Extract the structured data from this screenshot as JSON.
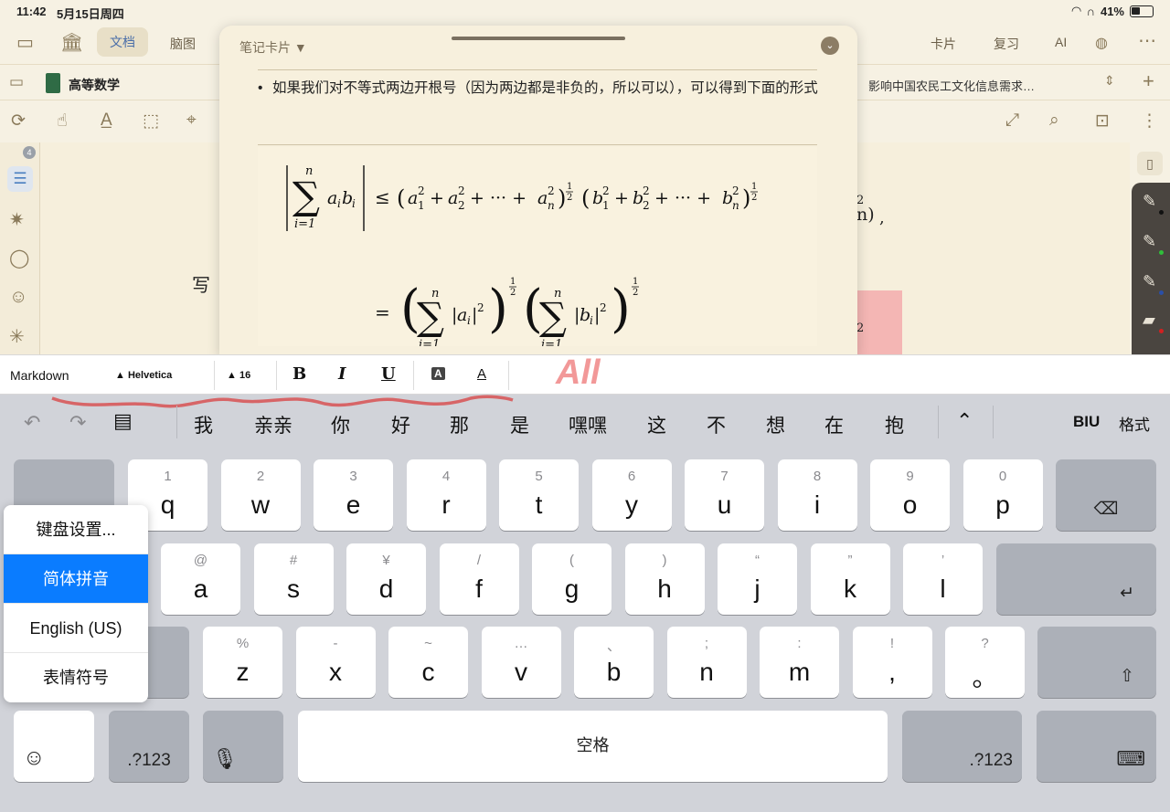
{
  "status": {
    "time": "11:42",
    "date": "5月15日周四",
    "battery": "41%"
  },
  "topbar": {
    "tab_doc": "文档",
    "tab_map": "脑图",
    "right_items": [
      "卡片",
      "复习",
      "AI"
    ]
  },
  "tabs": {
    "current_doc": "高等数学",
    "other_doc": "影响中国农民工文化信息需求…"
  },
  "left_badge": "4",
  "background": {
    "left_text": "写",
    "right_frag": "2",
    "right_frag2": "n)",
    "right_comma": ","
  },
  "card": {
    "header": "笔记卡片 ▼",
    "bullet": "如果我们对不等式两边开根号（因为两边都是非负的，所以可以），可以得到下面的形式"
  },
  "format_bar": {
    "mode": "Markdown",
    "font": "Helvetica",
    "size": "16",
    "bold": "B",
    "italic": "I",
    "underline": "U",
    "bg_a": "A",
    "fg_a": "A",
    "ink_mark": "All"
  },
  "keyboard": {
    "candidates": [
      "我",
      "亲亲",
      "你",
      "好",
      "那",
      "是",
      "嘿嘿",
      "这",
      "不",
      "想",
      "在",
      "抱"
    ],
    "right_biu": "BIU",
    "right_format": "格式",
    "row1": [
      {
        "sub": "1",
        "key": "q"
      },
      {
        "sub": "2",
        "key": "w"
      },
      {
        "sub": "3",
        "key": "e"
      },
      {
        "sub": "4",
        "key": "r"
      },
      {
        "sub": "5",
        "key": "t"
      },
      {
        "sub": "6",
        "key": "y"
      },
      {
        "sub": "7",
        "key": "u"
      },
      {
        "sub": "8",
        "key": "i"
      },
      {
        "sub": "9",
        "key": "o"
      },
      {
        "sub": "0",
        "key": "p"
      }
    ],
    "row2": [
      {
        "sub": "@",
        "key": "a"
      },
      {
        "sub": "#",
        "key": "s"
      },
      {
        "sub": "¥",
        "key": "d"
      },
      {
        "sub": "/",
        "key": "f"
      },
      {
        "sub": "(",
        "key": "g"
      },
      {
        "sub": ")",
        "key": "h"
      },
      {
        "sub": "“",
        "key": "j"
      },
      {
        "sub": "”",
        "key": "k"
      },
      {
        "sub": "’",
        "key": "l"
      }
    ],
    "row3": [
      {
        "sub": "%",
        "key": "z"
      },
      {
        "sub": "-",
        "key": "x"
      },
      {
        "sub": "~",
        "key": "c"
      },
      {
        "sub": "…",
        "key": "v"
      },
      {
        "sub": "、",
        "key": "b"
      },
      {
        "sub": ";",
        "key": "n"
      },
      {
        "sub": ":",
        "key": "m"
      },
      {
        "sub": "!",
        "key": ","
      },
      {
        "sub": "?",
        "key": "。"
      }
    ],
    "num_label": ".?123",
    "space_label": "空格"
  },
  "language_menu": {
    "items": [
      "键盘设置...",
      "简体拼音",
      "English (US)",
      "表情符号"
    ],
    "selected": "简体拼音"
  }
}
